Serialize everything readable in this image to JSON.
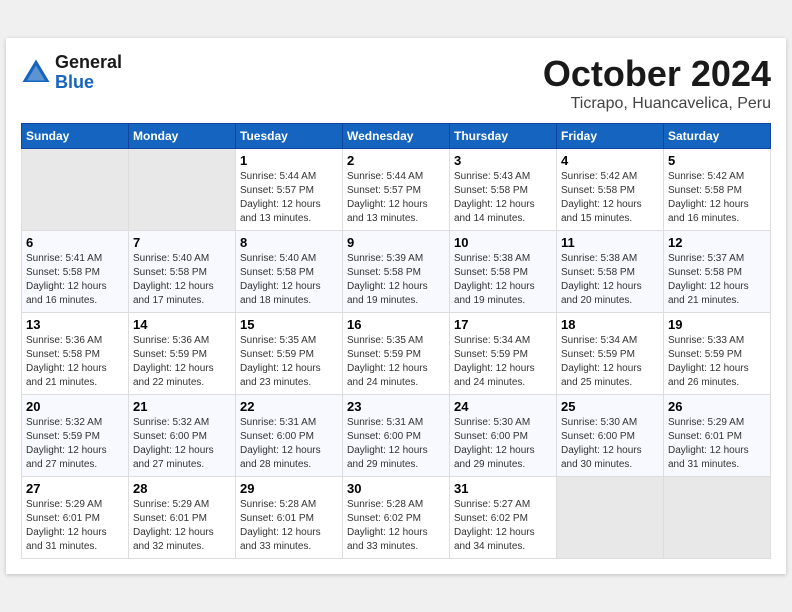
{
  "logo": {
    "line1": "General",
    "line2": "Blue"
  },
  "title": "October 2024",
  "subtitle": "Ticrapo, Huancavelica, Peru",
  "headers": [
    "Sunday",
    "Monday",
    "Tuesday",
    "Wednesday",
    "Thursday",
    "Friday",
    "Saturday"
  ],
  "weeks": [
    [
      {
        "day": "",
        "info": ""
      },
      {
        "day": "",
        "info": ""
      },
      {
        "day": "1",
        "info": "Sunrise: 5:44 AM\nSunset: 5:57 PM\nDaylight: 12 hours\nand 13 minutes."
      },
      {
        "day": "2",
        "info": "Sunrise: 5:44 AM\nSunset: 5:57 PM\nDaylight: 12 hours\nand 13 minutes."
      },
      {
        "day": "3",
        "info": "Sunrise: 5:43 AM\nSunset: 5:58 PM\nDaylight: 12 hours\nand 14 minutes."
      },
      {
        "day": "4",
        "info": "Sunrise: 5:42 AM\nSunset: 5:58 PM\nDaylight: 12 hours\nand 15 minutes."
      },
      {
        "day": "5",
        "info": "Sunrise: 5:42 AM\nSunset: 5:58 PM\nDaylight: 12 hours\nand 16 minutes."
      }
    ],
    [
      {
        "day": "6",
        "info": "Sunrise: 5:41 AM\nSunset: 5:58 PM\nDaylight: 12 hours\nand 16 minutes."
      },
      {
        "day": "7",
        "info": "Sunrise: 5:40 AM\nSunset: 5:58 PM\nDaylight: 12 hours\nand 17 minutes."
      },
      {
        "day": "8",
        "info": "Sunrise: 5:40 AM\nSunset: 5:58 PM\nDaylight: 12 hours\nand 18 minutes."
      },
      {
        "day": "9",
        "info": "Sunrise: 5:39 AM\nSunset: 5:58 PM\nDaylight: 12 hours\nand 19 minutes."
      },
      {
        "day": "10",
        "info": "Sunrise: 5:38 AM\nSunset: 5:58 PM\nDaylight: 12 hours\nand 19 minutes."
      },
      {
        "day": "11",
        "info": "Sunrise: 5:38 AM\nSunset: 5:58 PM\nDaylight: 12 hours\nand 20 minutes."
      },
      {
        "day": "12",
        "info": "Sunrise: 5:37 AM\nSunset: 5:58 PM\nDaylight: 12 hours\nand 21 minutes."
      }
    ],
    [
      {
        "day": "13",
        "info": "Sunrise: 5:36 AM\nSunset: 5:58 PM\nDaylight: 12 hours\nand 21 minutes."
      },
      {
        "day": "14",
        "info": "Sunrise: 5:36 AM\nSunset: 5:59 PM\nDaylight: 12 hours\nand 22 minutes."
      },
      {
        "day": "15",
        "info": "Sunrise: 5:35 AM\nSunset: 5:59 PM\nDaylight: 12 hours\nand 23 minutes."
      },
      {
        "day": "16",
        "info": "Sunrise: 5:35 AM\nSunset: 5:59 PM\nDaylight: 12 hours\nand 24 minutes."
      },
      {
        "day": "17",
        "info": "Sunrise: 5:34 AM\nSunset: 5:59 PM\nDaylight: 12 hours\nand 24 minutes."
      },
      {
        "day": "18",
        "info": "Sunrise: 5:34 AM\nSunset: 5:59 PM\nDaylight: 12 hours\nand 25 minutes."
      },
      {
        "day": "19",
        "info": "Sunrise: 5:33 AM\nSunset: 5:59 PM\nDaylight: 12 hours\nand 26 minutes."
      }
    ],
    [
      {
        "day": "20",
        "info": "Sunrise: 5:32 AM\nSunset: 5:59 PM\nDaylight: 12 hours\nand 27 minutes."
      },
      {
        "day": "21",
        "info": "Sunrise: 5:32 AM\nSunset: 6:00 PM\nDaylight: 12 hours\nand 27 minutes."
      },
      {
        "day": "22",
        "info": "Sunrise: 5:31 AM\nSunset: 6:00 PM\nDaylight: 12 hours\nand 28 minutes."
      },
      {
        "day": "23",
        "info": "Sunrise: 5:31 AM\nSunset: 6:00 PM\nDaylight: 12 hours\nand 29 minutes."
      },
      {
        "day": "24",
        "info": "Sunrise: 5:30 AM\nSunset: 6:00 PM\nDaylight: 12 hours\nand 29 minutes."
      },
      {
        "day": "25",
        "info": "Sunrise: 5:30 AM\nSunset: 6:00 PM\nDaylight: 12 hours\nand 30 minutes."
      },
      {
        "day": "26",
        "info": "Sunrise: 5:29 AM\nSunset: 6:01 PM\nDaylight: 12 hours\nand 31 minutes."
      }
    ],
    [
      {
        "day": "27",
        "info": "Sunrise: 5:29 AM\nSunset: 6:01 PM\nDaylight: 12 hours\nand 31 minutes."
      },
      {
        "day": "28",
        "info": "Sunrise: 5:29 AM\nSunset: 6:01 PM\nDaylight: 12 hours\nand 32 minutes."
      },
      {
        "day": "29",
        "info": "Sunrise: 5:28 AM\nSunset: 6:01 PM\nDaylight: 12 hours\nand 33 minutes."
      },
      {
        "day": "30",
        "info": "Sunrise: 5:28 AM\nSunset: 6:02 PM\nDaylight: 12 hours\nand 33 minutes."
      },
      {
        "day": "31",
        "info": "Sunrise: 5:27 AM\nSunset: 6:02 PM\nDaylight: 12 hours\nand 34 minutes."
      },
      {
        "day": "",
        "info": ""
      },
      {
        "day": "",
        "info": ""
      }
    ]
  ]
}
